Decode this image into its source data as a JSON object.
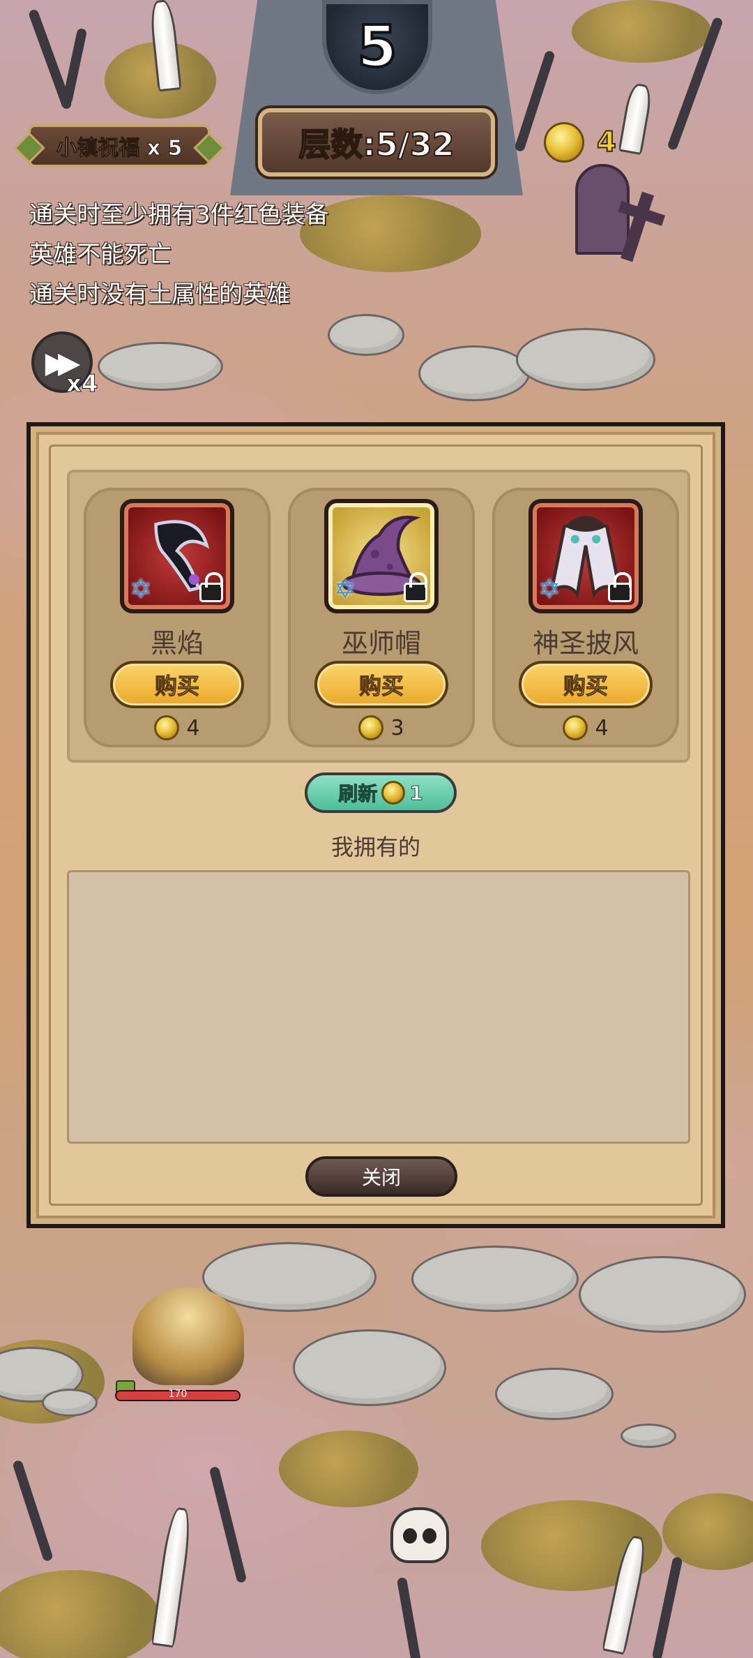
{
  "hud": {
    "wave_number": "5",
    "blessing_label": "小镇祝福 x 5",
    "floor_label": "层数:5/32",
    "coins": "4"
  },
  "conditions": [
    "通关时至少拥有3件红色装备",
    "英雄不能死亡",
    "通关时没有土属性的英雄"
  ],
  "speed": {
    "multiplier_label": "x4"
  },
  "shop": {
    "items": [
      {
        "name": "黑焰",
        "buy_label": "购买",
        "price": "4",
        "tile": "red",
        "icon": "dark-blade-icon"
      },
      {
        "name": "巫师帽",
        "buy_label": "购买",
        "price": "3",
        "tile": "gold",
        "icon": "wizard-hat-icon"
      },
      {
        "name": "神圣披风",
        "buy_label": "购买",
        "price": "4",
        "tile": "red",
        "icon": "holy-cloak-icon"
      }
    ],
    "refresh_label": "刷新",
    "refresh_cost": "1",
    "owned_title": "我拥有的",
    "close_label": "关闭"
  },
  "hero": {
    "hp": "170",
    "hp_fraction": 1.0
  },
  "colors": {
    "coin_gold": "#e7c23a",
    "buy_button": "#eba82a",
    "refresh_button": "#4fbf9b",
    "panel_bg": "#e2c79b"
  }
}
